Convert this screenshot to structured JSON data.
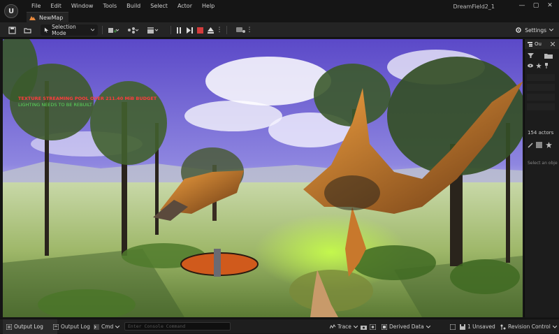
{
  "menubar": {
    "items": [
      "File",
      "Edit",
      "Window",
      "Tools",
      "Build",
      "Select",
      "Actor",
      "Help"
    ]
  },
  "window": {
    "project_name": "DreamField2_1",
    "min_glyph": "—",
    "max_glyph": "▢",
    "close_glyph": "✕"
  },
  "tab": {
    "label": "NewMap"
  },
  "toolbar": {
    "selection_mode_label": "Selection Mode",
    "settings_label": "Settings",
    "more_glyph": "⋮"
  },
  "viewport": {
    "overlay_line_1": "TEXTURE STREAMING POOL OVER 211.40 MiB BUDGET",
    "overlay_line_2": "LIGHTING NEEDS TO BE REBUILT"
  },
  "outliner": {
    "tab_label": "Ou",
    "actor_count": "154 actors",
    "select_hint": "Select an obje"
  },
  "statusbar": {
    "output_log_tab": "Output Log",
    "output_log": "Output Log",
    "cmd": "Cmd",
    "console_placeholder": "Enter Console Command",
    "trace": "Trace",
    "derived_data": "Derived Data",
    "unsaved": "1 Unsaved",
    "revision_control": "Revision Control"
  },
  "colors": {
    "accent_map_icon": "#e9893c",
    "stop_red": "#d43c3c",
    "chrome_dark": "#151515"
  }
}
